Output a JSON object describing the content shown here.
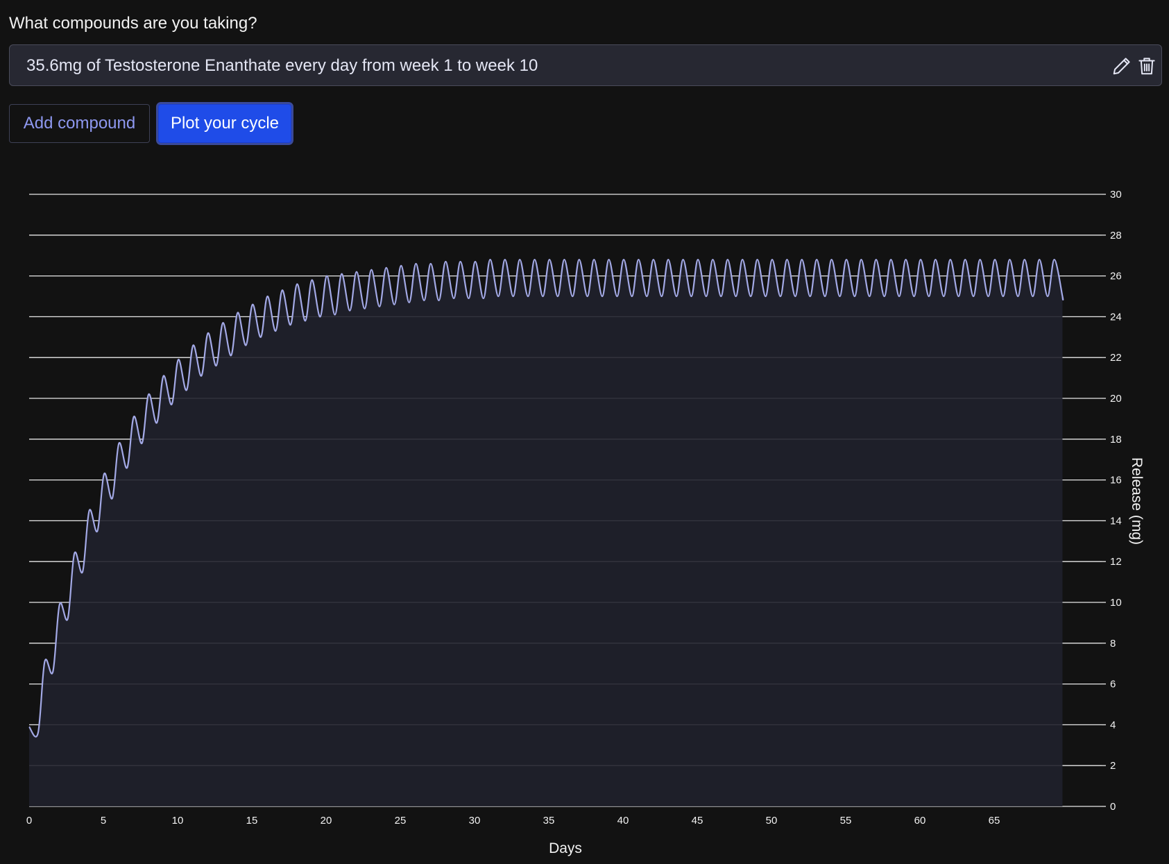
{
  "form": {
    "question": "What compounds are you taking?",
    "compound_entry": "35.6mg of Testosterone Enanthate every day from week 1 to week 10",
    "edit_icon": "pencil-icon",
    "delete_icon": "trash-icon",
    "add_button": "Add compound",
    "plot_button": "Plot your cycle"
  },
  "colors": {
    "background": "#121212",
    "line": "#a3a9e6",
    "area_fill": "#20212c",
    "gridline": "#e8e8e8",
    "primary_button": "#1f4ce8",
    "outline_button_text": "#8e98f0"
  },
  "chart_data": {
    "type": "area",
    "xlabel": "Days",
    "ylabel": "Release (mg)",
    "y_axis_side": "right",
    "xlim": [
      0,
      70
    ],
    "ylim": [
      0,
      30
    ],
    "x_ticks": [
      0,
      5,
      10,
      15,
      20,
      25,
      30,
      35,
      40,
      45,
      50,
      55,
      60,
      65
    ],
    "y_ticks": [
      0,
      2,
      4,
      6,
      8,
      10,
      12,
      14,
      16,
      18,
      20,
      22,
      24,
      26,
      28,
      30
    ],
    "grid": "horizontal",
    "series": [
      {
        "x_start": 0,
        "x_end": 69.6,
        "x_step": 1,
        "troughs": [
          3.6,
          6.6,
          9.2,
          11.5,
          13.5,
          15.1,
          16.6,
          17.8,
          18.8,
          19.7,
          20.4,
          21.1,
          21.6,
          22.1,
          22.6,
          23.0,
          23.3,
          23.6,
          23.8,
          24.0,
          24.1,
          24.3,
          24.4,
          24.5,
          24.6,
          24.7,
          24.8,
          24.8,
          24.9,
          24.9,
          24.9,
          25.0,
          25.0,
          25.0,
          25.0,
          25.0,
          25.0,
          25.0,
          25.0,
          25.0,
          25.0,
          25.0,
          25.0,
          25.0,
          25.0,
          25.0,
          25.0,
          25.0,
          25.0,
          25.0,
          25.0,
          25.0,
          25.0,
          25.0,
          25.0,
          25.0,
          25.0,
          25.0,
          25.0,
          25.0,
          25.0,
          25.0,
          25.0,
          25.0,
          25.0,
          25.0,
          25.0,
          25.0,
          25.0,
          25.0
        ],
        "peaks": [
          7.1,
          9.9,
          12.4,
          14.5,
          16.3,
          17.8,
          19.1,
          20.2,
          21.1,
          21.9,
          22.6,
          23.2,
          23.7,
          24.2,
          24.6,
          25.0,
          25.3,
          25.6,
          25.8,
          26.0,
          26.1,
          26.2,
          26.3,
          26.4,
          26.5,
          26.6,
          26.6,
          26.7,
          26.7,
          26.7,
          26.8,
          26.8,
          26.8,
          26.8,
          26.8,
          26.8,
          26.8,
          26.8,
          26.8,
          26.8,
          26.8,
          26.8,
          26.8,
          26.8,
          26.8,
          26.8,
          26.8,
          26.8,
          26.8,
          26.8,
          26.8,
          26.8,
          26.8,
          26.8,
          26.8,
          26.8,
          26.8,
          26.8,
          26.8,
          26.8,
          26.8,
          26.8,
          26.8,
          26.8,
          26.8,
          26.8,
          26.8,
          26.8,
          26.8,
          26.8
        ],
        "start_value": 3.9,
        "end_value": 24.9
      }
    ]
  }
}
